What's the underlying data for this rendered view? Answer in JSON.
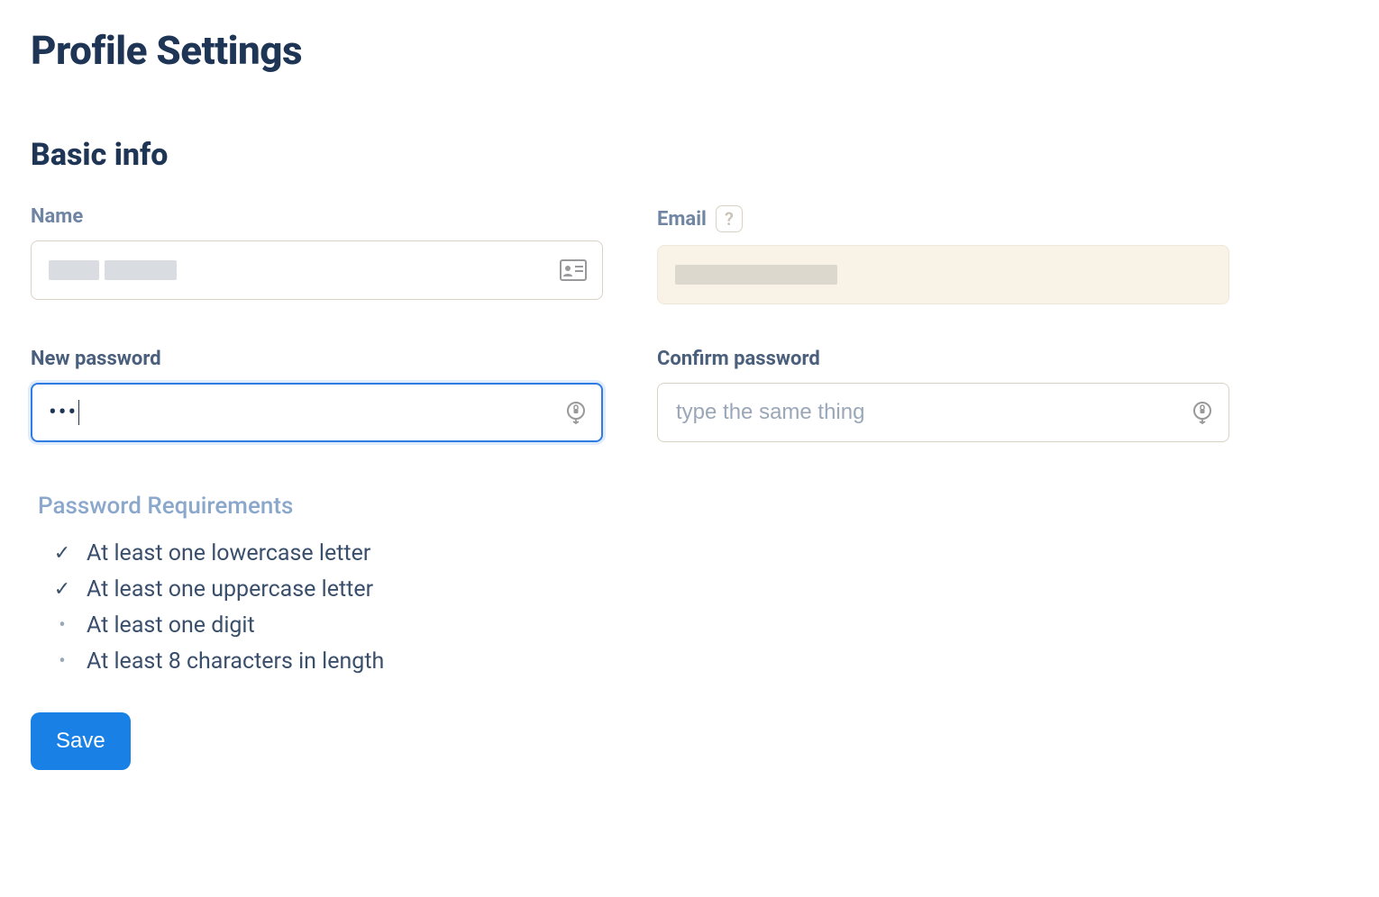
{
  "page": {
    "title": "Profile Settings"
  },
  "section": {
    "basic_info_title": "Basic info"
  },
  "fields": {
    "name": {
      "label": "Name",
      "value": ""
    },
    "email": {
      "label": "Email",
      "value": "",
      "help_symbol": "?"
    },
    "new_password": {
      "label": "New password",
      "value": "•••"
    },
    "confirm_password": {
      "label": "Confirm password",
      "placeholder": "type the same thing",
      "value": ""
    }
  },
  "password_requirements": {
    "title": "Password Requirements",
    "items": [
      {
        "met": true,
        "text": "At least one lowercase letter"
      },
      {
        "met": true,
        "text": "At least one uppercase letter"
      },
      {
        "met": false,
        "text": "At least one digit"
      },
      {
        "met": false,
        "text": "At least 8 characters in length"
      }
    ]
  },
  "actions": {
    "save_label": "Save"
  }
}
